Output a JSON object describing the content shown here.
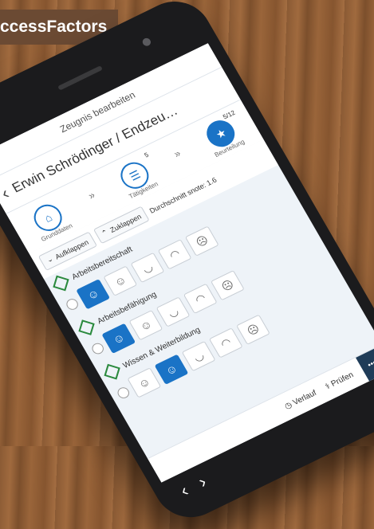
{
  "brand": "ccessFactors",
  "app": {
    "title": "Zeugnis bearbeiten",
    "crumb": "Erwin Schrödinger / Endzeu…"
  },
  "steps": [
    {
      "label": "Grunddaten",
      "badge": ""
    },
    {
      "label": "Tätigkeiten",
      "badge": "5"
    },
    {
      "label": "Beurteilung",
      "badge": "5/12"
    }
  ],
  "toolbar": {
    "expand": "Aufklappen",
    "collapse": "Zuklappen",
    "average": "Durchschnitt snote: 1.6"
  },
  "criteria": [
    {
      "label": "Arbeitsbereitschaft",
      "selected": 1
    },
    {
      "label": "Arbeitsbefähigung",
      "selected": 1
    },
    {
      "label": "Wissen & Weiterbildung",
      "selected": 2
    }
  ],
  "footer": {
    "history": "Verlauf",
    "check": "Prüfen"
  },
  "colors": {
    "accent": "#1a73c6",
    "brand_bar": "#6b4a33",
    "diamond": "#2b8a3e"
  }
}
